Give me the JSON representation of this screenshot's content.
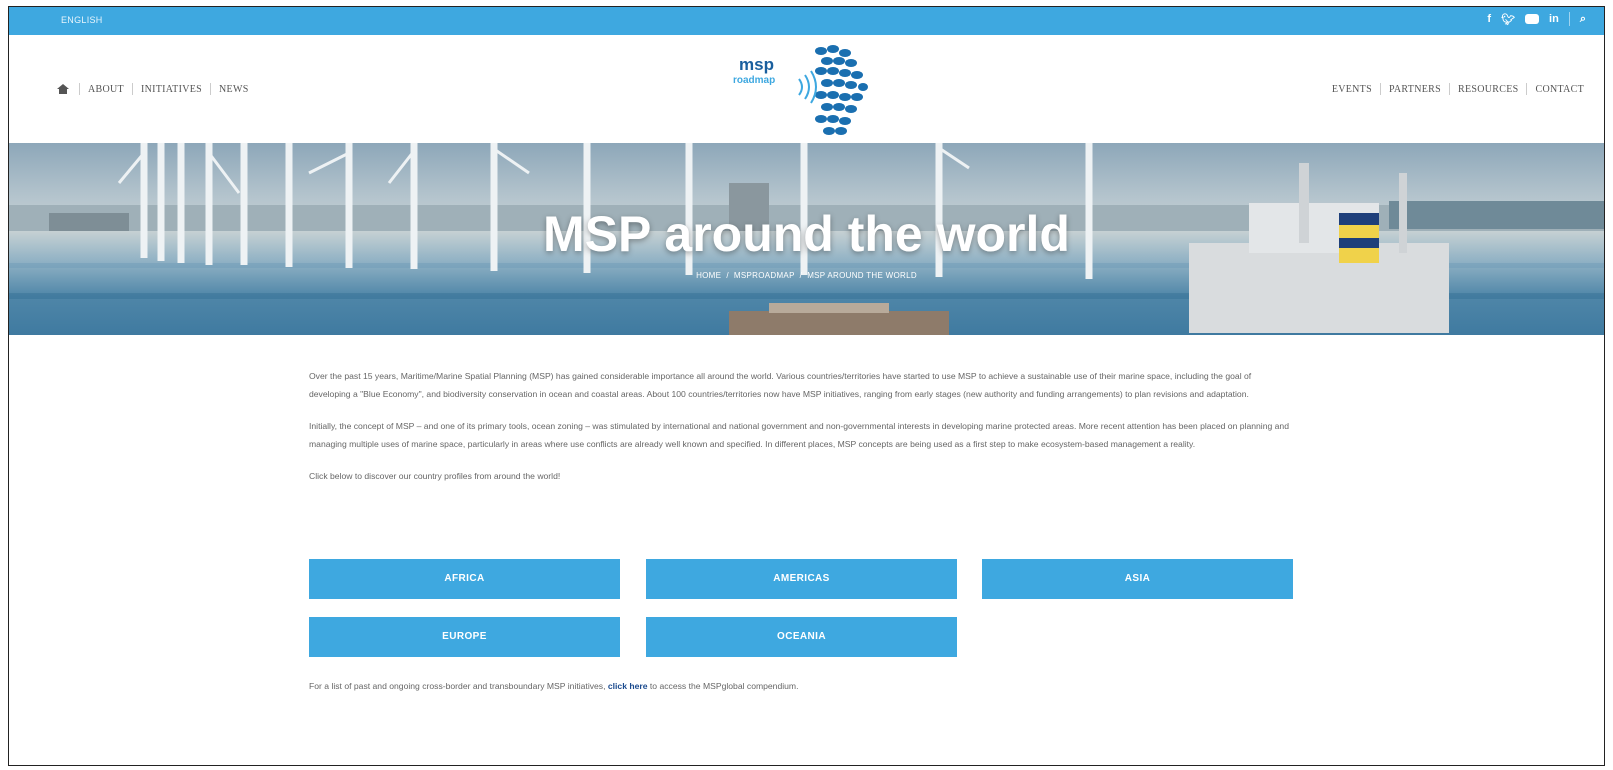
{
  "topbar": {
    "language": "ENGLISH"
  },
  "nav_left": [
    {
      "label": "ABOUT"
    },
    {
      "label": "INITIATIVES"
    },
    {
      "label": "NEWS"
    }
  ],
  "nav_right": [
    {
      "label": "EVENTS"
    },
    {
      "label": "PARTNERS"
    },
    {
      "label": "RESOURCES"
    },
    {
      "label": "CONTACT"
    }
  ],
  "logo": {
    "line1": "msp",
    "line2": "roadmap"
  },
  "hero": {
    "title": "MSP around the world",
    "breadcrumb": [
      "HOME",
      "MSPROADMAP",
      "MSP AROUND THE WORLD"
    ]
  },
  "content": {
    "paragraphs": [
      "Over the past 15 years, Maritime/Marine Spatial Planning (MSP) has gained considerable importance all around the world. Various countries/territories have started to use MSP to achieve a sustainable use of their marine space, including the goal of developing a \"Blue Economy\", and biodiversity conservation in ocean and coastal areas. About 100 countries/territories now have MSP initiatives, ranging from early stages (new authority and funding arrangements) to plan revisions and adaptation.",
      "Initially, the concept of MSP – and one of its primary tools, ocean zoning – was stimulated by international and national government and non-governmental interests in developing marine protected areas. More recent attention has been placed on planning and managing multiple uses of marine space, particularly in areas where use conflicts are already well known and specified. In different places, MSP concepts are being used as a first step to make ecosystem-based management a reality.",
      "Click below to discover our country profiles from around the world!"
    ],
    "regions": [
      "AFRICA",
      "AMERICAS",
      "ASIA",
      "EUROPE",
      "OCEANIA"
    ],
    "footnote_before": "For a list of past and ongoing cross-border and transboundary MSP initiatives,",
    "footnote_link": "click here",
    "footnote_after": "to access the MSPglobal compendium."
  },
  "colors": {
    "accent": "#3ea8e0",
    "link": "#1a4a8e"
  }
}
